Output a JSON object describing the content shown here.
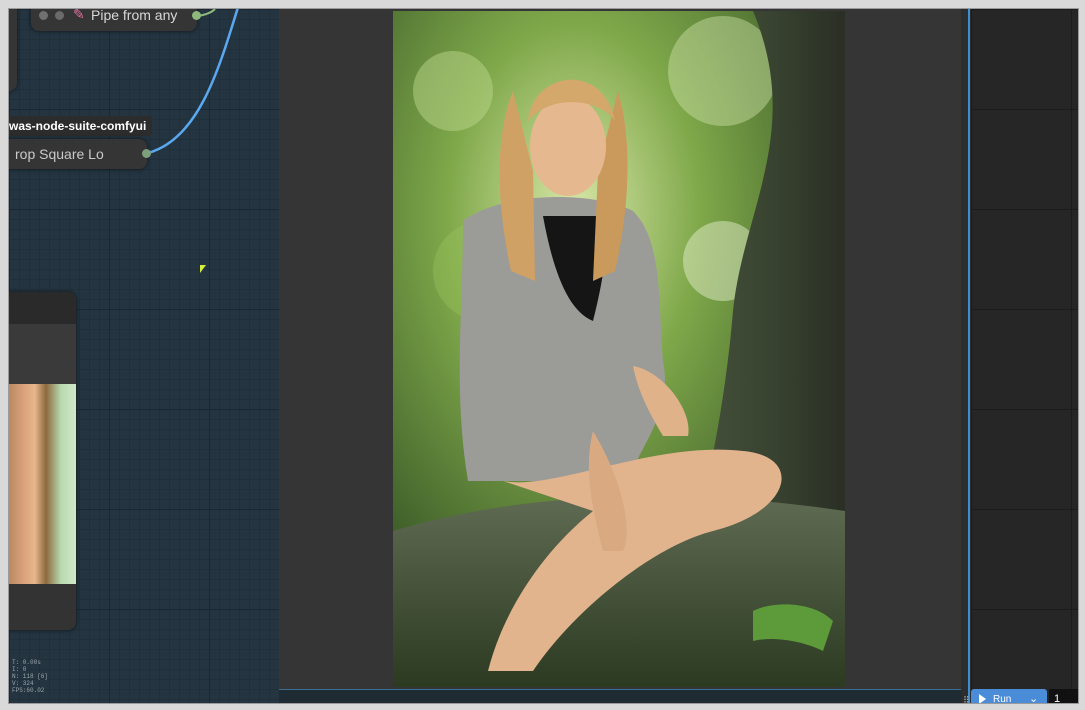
{
  "nodes": {
    "pipe": {
      "title": "Pipe from any",
      "icon": "paint-brush-icon"
    },
    "badge": "was-node-suite-comfyui",
    "crop": {
      "title": "rop Square Lo"
    }
  },
  "stats": [
    "T: 0.00s",
    "I: 0",
    "N: 118 [6]",
    "V: 324",
    "FPS:60.02"
  ],
  "run": {
    "label": "Run",
    "queue_count": "1"
  },
  "colors": {
    "link": "#5aa9f0",
    "accent": "#4a8cd8"
  }
}
